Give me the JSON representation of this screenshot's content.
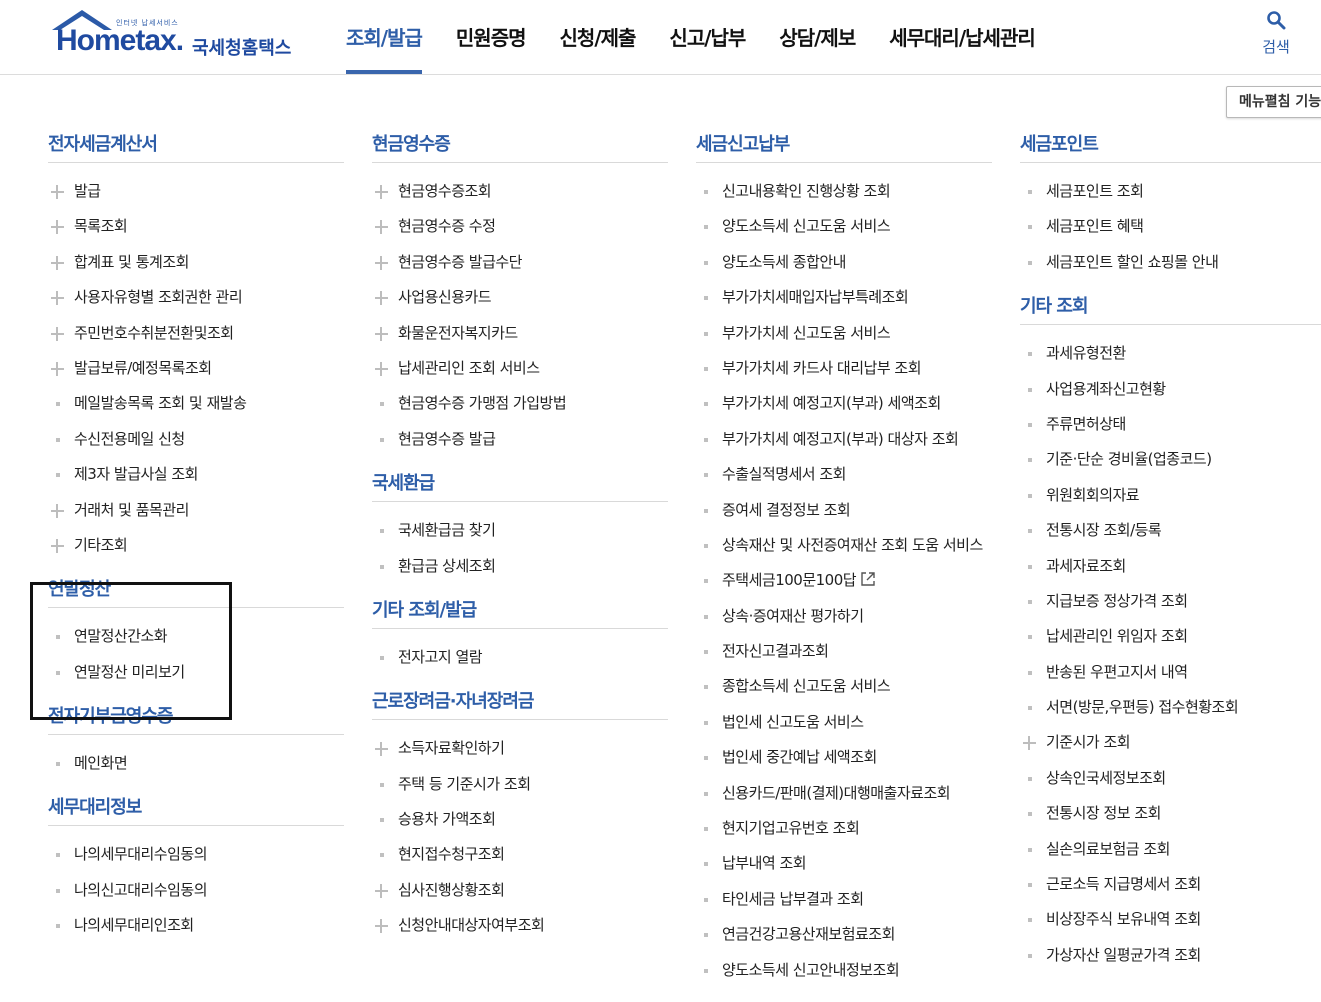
{
  "logo": {
    "small": "인터넷 납세서비스",
    "main": "Hometax.",
    "sub": "국세청홈택스"
  },
  "nav": [
    "조회/발급",
    "민원증명",
    "신청/제출",
    "신고/납부",
    "상담/제보",
    "세무대리/납세관리"
  ],
  "nav_active_index": 0,
  "search_label": "검색",
  "menu_toggle_label": "메뉴펼침 기능",
  "columns": [
    [
      {
        "title": "전자세금계산서",
        "items": [
          {
            "label": "발급",
            "marker": "plus"
          },
          {
            "label": "목록조회",
            "marker": "plus"
          },
          {
            "label": "합계표 및 통계조회",
            "marker": "plus"
          },
          {
            "label": "사용자유형별 조회권한 관리",
            "marker": "plus"
          },
          {
            "label": "주민번호수취분전환및조회",
            "marker": "plus"
          },
          {
            "label": "발급보류/예정목록조회",
            "marker": "plus"
          },
          {
            "label": "메일발송목록 조회 및 재발송",
            "marker": "bullet"
          },
          {
            "label": "수신전용메일 신청",
            "marker": "bullet"
          },
          {
            "label": "제3자 발급사실 조회",
            "marker": "bullet"
          },
          {
            "label": "거래처 및 품목관리",
            "marker": "plus"
          },
          {
            "label": "기타조회",
            "marker": "plus"
          }
        ]
      },
      {
        "title": "연말정산",
        "items": [
          {
            "label": "연말정산간소화",
            "marker": "bullet"
          },
          {
            "label": "연말정산 미리보기",
            "marker": "bullet"
          }
        ]
      },
      {
        "title": "전자기부금영수증",
        "items": [
          {
            "label": "메인화면",
            "marker": "bullet"
          }
        ]
      },
      {
        "title": "세무대리정보",
        "items": [
          {
            "label": "나의세무대리수임동의",
            "marker": "bullet"
          },
          {
            "label": "나의신고대리수임동의",
            "marker": "bullet"
          },
          {
            "label": "나의세무대리인조회",
            "marker": "bullet"
          }
        ]
      }
    ],
    [
      {
        "title": "현금영수증",
        "items": [
          {
            "label": "현금영수증조회",
            "marker": "plus"
          },
          {
            "label": "현금영수증 수정",
            "marker": "plus"
          },
          {
            "label": "현금영수증 발급수단",
            "marker": "plus"
          },
          {
            "label": "사업용신용카드",
            "marker": "plus"
          },
          {
            "label": "화물운전자복지카드",
            "marker": "plus"
          },
          {
            "label": "납세관리인 조회 서비스",
            "marker": "plus"
          },
          {
            "label": "현금영수증 가맹점 가입방법",
            "marker": "bullet"
          },
          {
            "label": "현금영수증 발급",
            "marker": "bullet"
          }
        ]
      },
      {
        "title": "국세환급",
        "items": [
          {
            "label": "국세환급금 찾기",
            "marker": "bullet"
          },
          {
            "label": "환급금 상세조회",
            "marker": "bullet"
          }
        ]
      },
      {
        "title": "기타 조회/발급",
        "items": [
          {
            "label": "전자고지 열람",
            "marker": "bullet"
          }
        ]
      },
      {
        "title": "근로장려금·자녀장려금",
        "items": [
          {
            "label": "소득자료확인하기",
            "marker": "plus"
          },
          {
            "label": "주택 등 기준시가 조회",
            "marker": "bullet"
          },
          {
            "label": "승용차 가액조회",
            "marker": "bullet"
          },
          {
            "label": "현지접수청구조회",
            "marker": "bullet"
          },
          {
            "label": "심사진행상황조회",
            "marker": "plus"
          },
          {
            "label": "신청안내대상자여부조회",
            "marker": "plus"
          }
        ]
      }
    ],
    [
      {
        "title": "세금신고납부",
        "items": [
          {
            "label": "신고내용확인 진행상황 조회",
            "marker": "bullet"
          },
          {
            "label": "양도소득세 신고도움 서비스",
            "marker": "bullet"
          },
          {
            "label": "양도소득세 종합안내",
            "marker": "bullet"
          },
          {
            "label": "부가가치세매입자납부특례조회",
            "marker": "bullet"
          },
          {
            "label": "부가가치세 신고도움 서비스",
            "marker": "bullet"
          },
          {
            "label": "부가가치세 카드사 대리납부 조회",
            "marker": "bullet"
          },
          {
            "label": "부가가치세 예정고지(부과) 세액조회",
            "marker": "bullet"
          },
          {
            "label": "부가가치세 예정고지(부과) 대상자 조회",
            "marker": "bullet"
          },
          {
            "label": "수출실적명세서 조회",
            "marker": "bullet"
          },
          {
            "label": "증여세 결정정보 조회",
            "marker": "bullet"
          },
          {
            "label": "상속재산 및 사전증여재산 조회 도움 서비스",
            "marker": "bullet"
          },
          {
            "label": "주택세금100문100답",
            "marker": "bullet",
            "external": true
          },
          {
            "label": "상속·증여재산 평가하기",
            "marker": "bullet"
          },
          {
            "label": "전자신고결과조회",
            "marker": "bullet"
          },
          {
            "label": "종합소득세 신고도움 서비스",
            "marker": "bullet"
          },
          {
            "label": "법인세 신고도움 서비스",
            "marker": "bullet"
          },
          {
            "label": "법인세 중간예납 세액조회",
            "marker": "bullet"
          },
          {
            "label": "신용카드/판매(결제)대행매출자료조회",
            "marker": "bullet"
          },
          {
            "label": "현지기업고유번호 조회",
            "marker": "bullet"
          },
          {
            "label": "납부내역 조회",
            "marker": "bullet"
          },
          {
            "label": "타인세금 납부결과 조회",
            "marker": "bullet"
          },
          {
            "label": "연금건강고용산재보험료조회",
            "marker": "bullet"
          },
          {
            "label": "양도소득세 신고안내정보조회",
            "marker": "bullet"
          }
        ]
      }
    ],
    [
      {
        "title": "세금포인트",
        "items": [
          {
            "label": "세금포인트 조회",
            "marker": "bullet"
          },
          {
            "label": "세금포인트 혜택",
            "marker": "bullet"
          },
          {
            "label": "세금포인트 할인 쇼핑몰 안내",
            "marker": "bullet"
          }
        ]
      },
      {
        "title": "기타 조회",
        "items": [
          {
            "label": "과세유형전환",
            "marker": "bullet"
          },
          {
            "label": "사업용계좌신고현황",
            "marker": "bullet"
          },
          {
            "label": "주류면허상태",
            "marker": "bullet"
          },
          {
            "label": "기준·단순 경비율(업종코드)",
            "marker": "bullet"
          },
          {
            "label": "위원회회의자료",
            "marker": "bullet"
          },
          {
            "label": "전통시장 조회/등록",
            "marker": "bullet"
          },
          {
            "label": "과세자료조회",
            "marker": "bullet"
          },
          {
            "label": "지급보증 정상가격 조회",
            "marker": "bullet"
          },
          {
            "label": "납세관리인 위임자 조회",
            "marker": "bullet"
          },
          {
            "label": "반송된 우편고지서 내역",
            "marker": "bullet"
          },
          {
            "label": "서면(방문,우편등) 접수현황조회",
            "marker": "bullet"
          },
          {
            "label": "기준시가 조회",
            "marker": "plus"
          },
          {
            "label": "상속인국세정보조회",
            "marker": "bullet"
          },
          {
            "label": "전통시장 정보 조회",
            "marker": "bullet"
          },
          {
            "label": "실손의료보험금 조회",
            "marker": "bullet"
          },
          {
            "label": "근로소득 지급명세서 조회",
            "marker": "bullet"
          },
          {
            "label": "비상장주식 보유내역 조회",
            "marker": "bullet"
          },
          {
            "label": "가상자산 일평균가격 조회",
            "marker": "bullet"
          }
        ]
      }
    ]
  ]
}
